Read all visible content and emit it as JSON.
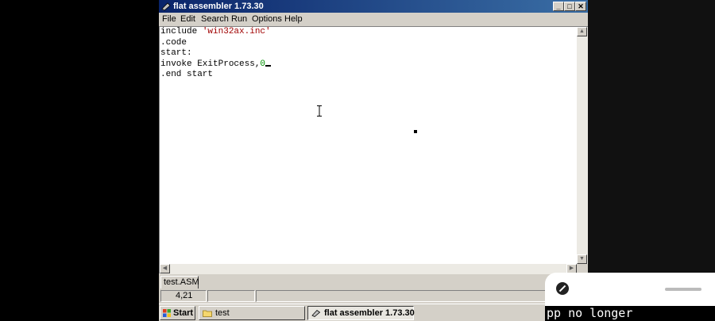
{
  "window": {
    "title": "flat assembler 1.73.30",
    "controls": {
      "minimize": "_",
      "maximize": "□",
      "close": "✕"
    }
  },
  "menu": {
    "items": [
      "File",
      "Edit",
      "Search",
      "Run",
      "Options",
      "Help"
    ]
  },
  "editor": {
    "lines": [
      {
        "segments": [
          {
            "text": "include ",
            "kind": "plain"
          },
          {
            "text": "'win32ax.inc'",
            "kind": "string"
          }
        ]
      },
      {
        "segments": [
          {
            "text": ".code",
            "kind": "plain"
          }
        ]
      },
      {
        "segments": [
          {
            "text": "start:",
            "kind": "plain"
          }
        ]
      },
      {
        "segments": [
          {
            "text": "invoke ExitProcess,",
            "kind": "plain"
          },
          {
            "text": "0",
            "kind": "number"
          }
        ]
      },
      {
        "segments": [
          {
            "text": ".end start",
            "kind": "plain"
          }
        ]
      }
    ],
    "caret_line": 3,
    "colors": {
      "string": "#a00000",
      "number": "#009000"
    }
  },
  "tabs": [
    {
      "label": "test.ASM"
    }
  ],
  "status": {
    "position": "4,21"
  },
  "taskbar": {
    "start_label": "Start",
    "buttons": [
      {
        "label": "test",
        "icon": "folder-icon",
        "active": false
      },
      {
        "label": "flat assembler 1.73.30",
        "icon": "fasm-icon",
        "active": true
      }
    ]
  },
  "overlay": {
    "caption": "pp no longer"
  },
  "colors": {
    "titlebar_start": "#0a246a",
    "titlebar_end": "#3a6ea5",
    "chrome": "#d4d0c8"
  }
}
